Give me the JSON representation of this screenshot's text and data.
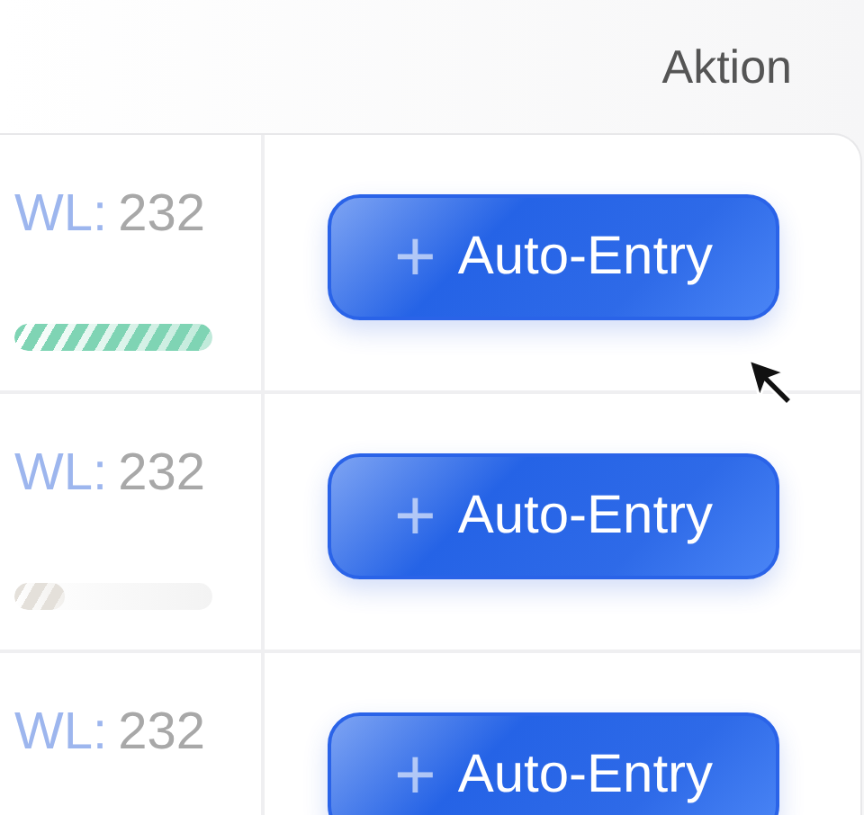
{
  "table": {
    "columns": [
      {
        "label": "Aktion"
      }
    ],
    "rows": [
      {
        "label": "WL:",
        "value": "232",
        "level": 1.0,
        "color": "#7fd4b4",
        "action": "Auto-Entry",
        "action_icon": "+"
      },
      {
        "label": "WL:",
        "value": "232",
        "level": 0.25,
        "color": "#e4e0da",
        "action": "Auto-Entry",
        "action_icon": "+"
      },
      {
        "label": "WL:",
        "value": "232",
        "action": "Auto-Entry",
        "action_icon": "+"
      }
    ]
  }
}
